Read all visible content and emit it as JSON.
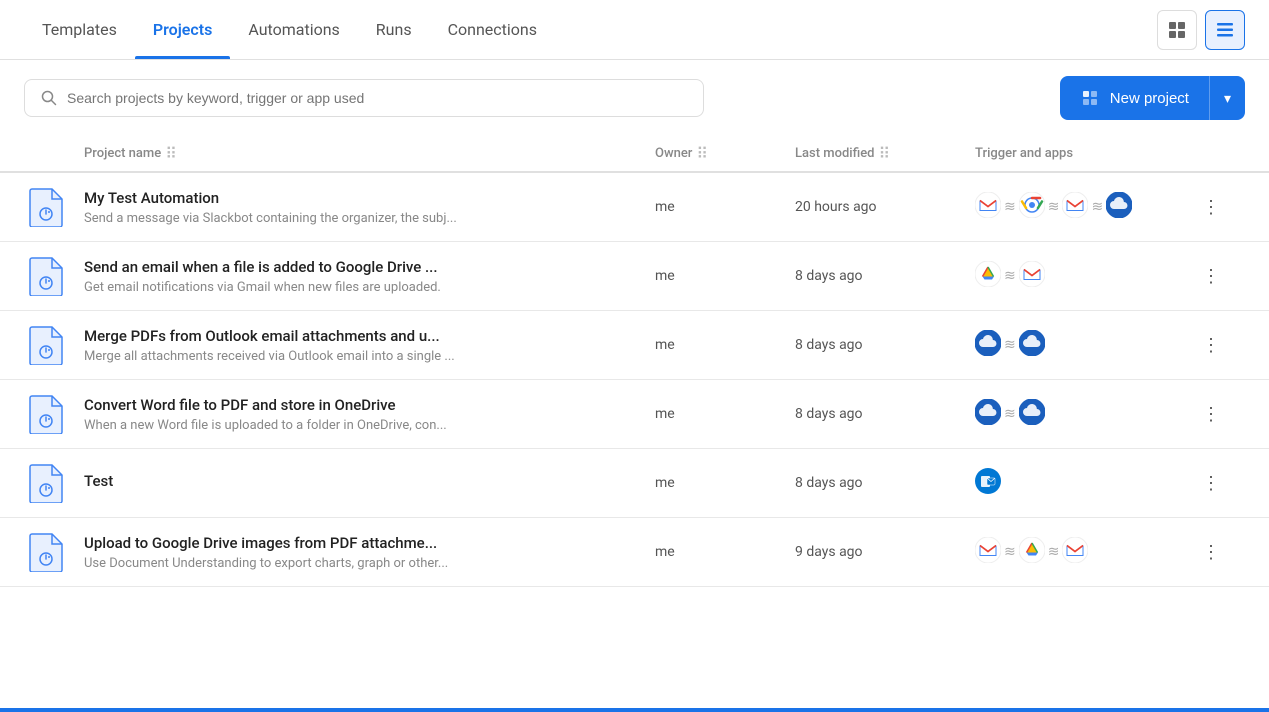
{
  "nav": {
    "tabs": [
      {
        "id": "templates",
        "label": "Templates",
        "active": false
      },
      {
        "id": "projects",
        "label": "Projects",
        "active": true
      },
      {
        "id": "automations",
        "label": "Automations",
        "active": false
      },
      {
        "id": "runs",
        "label": "Runs",
        "active": false
      },
      {
        "id": "connections",
        "label": "Connections",
        "active": false
      }
    ]
  },
  "toolbar": {
    "search_placeholder": "Search projects by keyword, trigger or app used",
    "new_project_label": "New project",
    "dropdown_arrow": "▾"
  },
  "table": {
    "headers": {
      "project_name": "Project name",
      "owner": "Owner",
      "last_modified": "Last modified",
      "trigger_apps": "Trigger and apps"
    },
    "rows": [
      {
        "id": 1,
        "name": "My Test Automation",
        "desc": "Send a message via Slackbot containing the organizer, the subj...",
        "owner": "me",
        "modified": "20 hours ago",
        "apps": [
          "gmail",
          "chrome",
          "gmail2",
          "cloud"
        ]
      },
      {
        "id": 2,
        "name": "Send an email when a file is added to Google Drive ...",
        "desc": "Get email notifications via Gmail when new files are uploaded.",
        "owner": "me",
        "modified": "8 days ago",
        "apps": [
          "gdrive",
          "gmail"
        ]
      },
      {
        "id": 3,
        "name": "Merge PDFs from Outlook email attachments and u...",
        "desc": "Merge all attachments received via Outlook email into a single ...",
        "owner": "me",
        "modified": "8 days ago",
        "apps": [
          "cloud1",
          "cloud2"
        ]
      },
      {
        "id": 4,
        "name": "Convert Word file to PDF and store in OneDrive",
        "desc": "When a new Word file is uploaded to a folder in OneDrive, con...",
        "owner": "me",
        "modified": "8 days ago",
        "apps": [
          "cloud1",
          "cloud2"
        ]
      },
      {
        "id": 5,
        "name": "Test",
        "desc": "",
        "owner": "me",
        "modified": "8 days ago",
        "apps": [
          "outlook"
        ]
      },
      {
        "id": 6,
        "name": "Upload to Google Drive images from PDF attachme...",
        "desc": "Use Document Understanding to export charts, graph or other...",
        "owner": "me",
        "modified": "9 days ago",
        "apps": [
          "gmail",
          "gdrive",
          "gmail2"
        ]
      }
    ]
  }
}
